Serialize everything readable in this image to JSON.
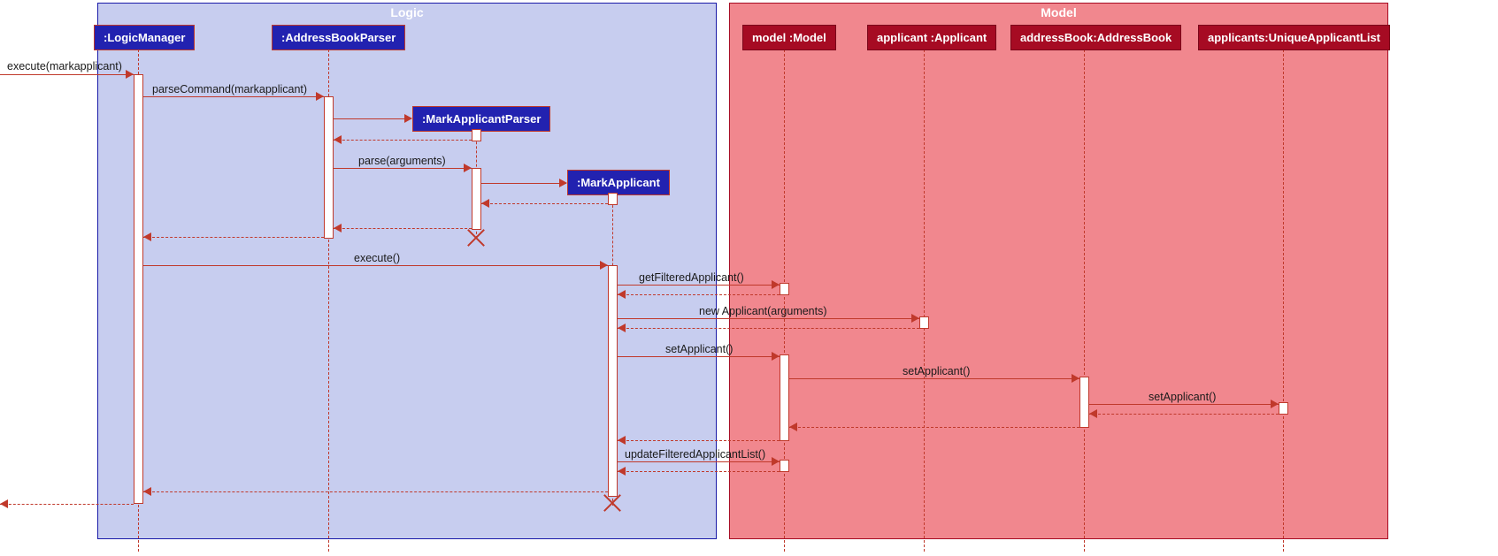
{
  "packages": {
    "logic": "Logic",
    "model": "Model"
  },
  "participants": {
    "logicManager": ":LogicManager",
    "addressBookParser": ":AddressBookParser",
    "markApplicantParser": ":MarkApplicantParser",
    "markApplicant": ":MarkApplicant",
    "model": "model :Model",
    "applicant": "applicant :Applicant",
    "addressBook": "addressBook:AddressBook",
    "applicants": "applicants:UniqueApplicantList"
  },
  "messages": {
    "executeMark": "execute(markapplicant)",
    "parseCommand": "parseCommand(markapplicant)",
    "parseArgs": "parse(arguments)",
    "execute": "execute()",
    "getFiltered": "getFilteredApplicant()",
    "newApplicant": "new Applicant(arguments)",
    "setApplicant": "setApplicant()",
    "updateFiltered": "updateFilteredApplicantList()"
  },
  "chart_data": {
    "type": "uml-sequence-diagram",
    "packages": [
      {
        "name": "Logic",
        "participants": [
          "LogicManager",
          "AddressBookParser",
          "MarkApplicantParser",
          "MarkApplicant"
        ]
      },
      {
        "name": "Model",
        "participants": [
          "model :Model",
          "applicant :Applicant",
          "addressBook:AddressBook",
          "applicants:UniqueApplicantList"
        ]
      }
    ],
    "interactions": [
      {
        "from": "caller",
        "to": "LogicManager",
        "msg": "execute(markapplicant)",
        "type": "sync"
      },
      {
        "from": "LogicManager",
        "to": "AddressBookParser",
        "msg": "parseCommand(markapplicant)",
        "type": "sync"
      },
      {
        "from": "AddressBookParser",
        "to": "MarkApplicantParser",
        "msg": "<<create>>",
        "type": "sync"
      },
      {
        "from": "MarkApplicantParser",
        "to": "AddressBookParser",
        "msg": "",
        "type": "return"
      },
      {
        "from": "AddressBookParser",
        "to": "MarkApplicantParser",
        "msg": "parse(arguments)",
        "type": "sync"
      },
      {
        "from": "MarkApplicantParser",
        "to": "MarkApplicant",
        "msg": "<<create>>",
        "type": "sync"
      },
      {
        "from": "MarkApplicant",
        "to": "MarkApplicantParser",
        "msg": "",
        "type": "return"
      },
      {
        "from": "MarkApplicantParser",
        "to": "AddressBookParser",
        "msg": "",
        "type": "return",
        "destroy": "MarkApplicantParser"
      },
      {
        "from": "AddressBookParser",
        "to": "LogicManager",
        "msg": "",
        "type": "return"
      },
      {
        "from": "LogicManager",
        "to": "MarkApplicant",
        "msg": "execute()",
        "type": "sync"
      },
      {
        "from": "MarkApplicant",
        "to": "model :Model",
        "msg": "getFilteredApplicant()",
        "type": "sync"
      },
      {
        "from": "model :Model",
        "to": "MarkApplicant",
        "msg": "",
        "type": "return"
      },
      {
        "from": "MarkApplicant",
        "to": "applicant :Applicant",
        "msg": "new Applicant(arguments)",
        "type": "sync"
      },
      {
        "from": "applicant :Applicant",
        "to": "MarkApplicant",
        "msg": "",
        "type": "return"
      },
      {
        "from": "MarkApplicant",
        "to": "model :Model",
        "msg": "setApplicant()",
        "type": "sync"
      },
      {
        "from": "model :Model",
        "to": "addressBook:AddressBook",
        "msg": "setApplicant()",
        "type": "sync"
      },
      {
        "from": "addressBook:AddressBook",
        "to": "applicants:UniqueApplicantList",
        "msg": "setApplicant()",
        "type": "sync"
      },
      {
        "from": "applicants:UniqueApplicantList",
        "to": "addressBook:AddressBook",
        "msg": "",
        "type": "return"
      },
      {
        "from": "addressBook:AddressBook",
        "to": "model :Model",
        "msg": "",
        "type": "return"
      },
      {
        "from": "model :Model",
        "to": "MarkApplicant",
        "msg": "",
        "type": "return"
      },
      {
        "from": "MarkApplicant",
        "to": "model :Model",
        "msg": "updateFilteredApplicantList()",
        "type": "sync"
      },
      {
        "from": "model :Model",
        "to": "MarkApplicant",
        "msg": "",
        "type": "return"
      },
      {
        "from": "MarkApplicant",
        "to": "LogicManager",
        "msg": "",
        "type": "return",
        "destroy": "MarkApplicant"
      },
      {
        "from": "LogicManager",
        "to": "caller",
        "msg": "",
        "type": "return"
      }
    ]
  }
}
